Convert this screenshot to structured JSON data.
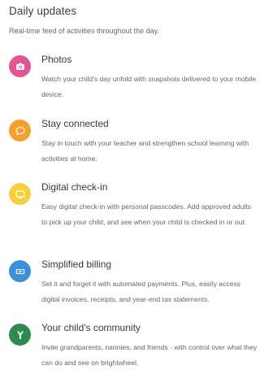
{
  "header": {
    "title": "Daily updates",
    "subtitle": "Real-time feed of activities throughout the day."
  },
  "features": [
    {
      "title": "Photos",
      "description": "Watch your child's day unfold with snapshots delivered to your mobile device.",
      "icon": "camera-icon",
      "color": "#e05594"
    },
    {
      "title": "Stay connected",
      "description": "Stay in touch with your teacher and strengthen school learning with activities at home.",
      "icon": "chat-bubble-icon",
      "color": "#f4a12b"
    },
    {
      "title": "Digital check-in",
      "description": "Easy digital check-in with personal passcodes. Add approved adults to pick up your child, and see when your child is checked in or out.",
      "icon": "tablet-icon",
      "color": "#f6cf3c"
    },
    {
      "title": "Simplified billing",
      "description": "Set it and forget it with automated payments. Plus, easily access digital invoices, receipts, and year-end tax statements.",
      "icon": "money-icon",
      "color": "#3d8fd9"
    },
    {
      "title": "Your child's community",
      "description": "Invite grandparents, nannies, and friends - with control over what they can do and see on brightwheel.",
      "icon": "tree-icon",
      "color": "#2e8a4e"
    }
  ]
}
